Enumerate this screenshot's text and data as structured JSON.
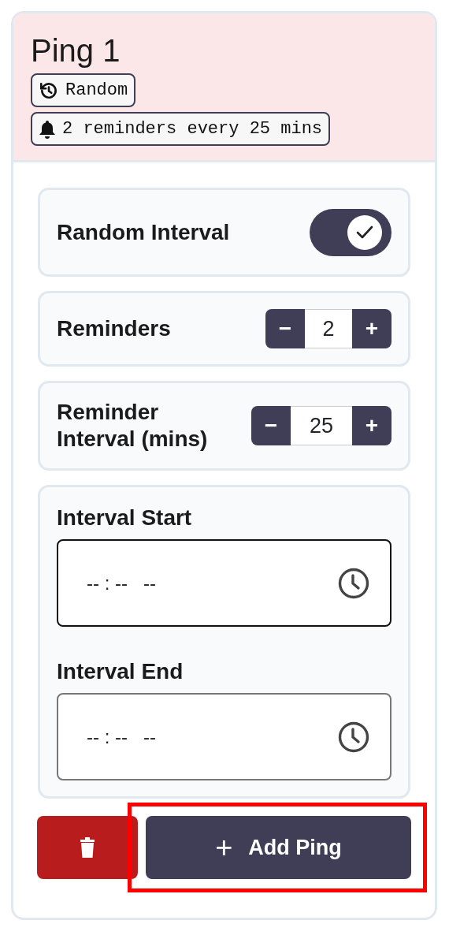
{
  "title": "Ping 1",
  "badges": [
    {
      "kind": "schedule",
      "text": "Random"
    },
    {
      "kind": "reminder",
      "text": "2 reminders every 25 mins"
    }
  ],
  "settings": [
    {
      "kind": "toggle",
      "label": "Random Interval",
      "on": true
    },
    {
      "kind": "stepper",
      "label": "Reminders",
      "value": "2",
      "minus": "−",
      "plus": "+"
    },
    {
      "kind": "stepper",
      "label": "Reminder Interval (mins)",
      "value": "25",
      "minus": "−",
      "plus": "+"
    }
  ],
  "time_fields": [
    {
      "label": "Interval Start",
      "value": "-- : --   --",
      "focused": true
    },
    {
      "label": "Interval End",
      "value": "-- : --   --",
      "focused": false
    }
  ],
  "add_button": {
    "label": "Add Ping",
    "icon": "+",
    "highlighted": true
  }
}
